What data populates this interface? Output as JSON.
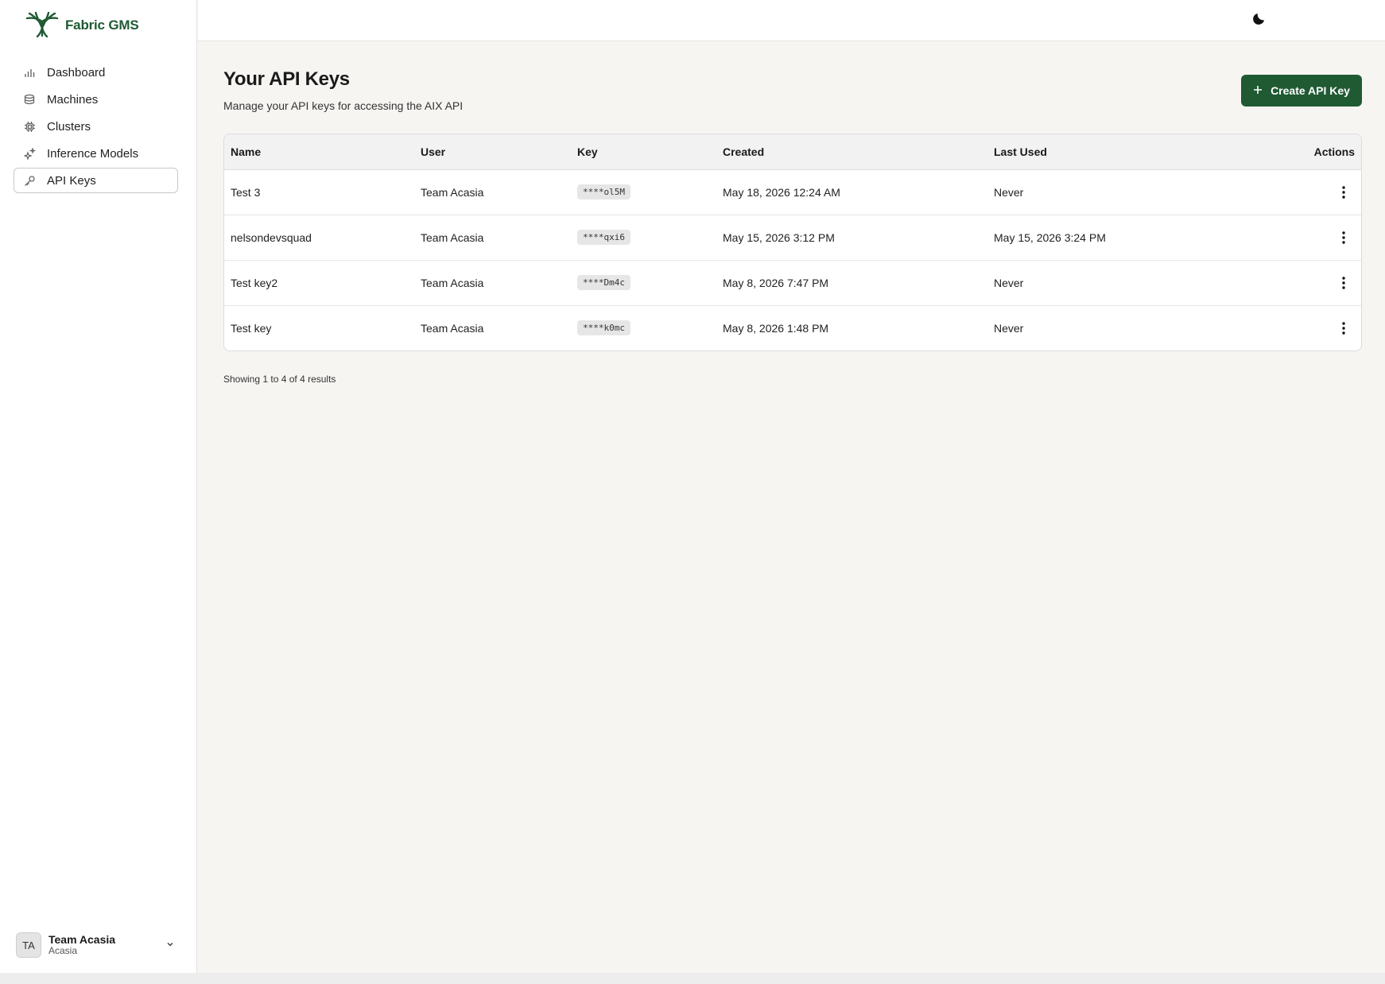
{
  "brand": {
    "name": "Fabric GMS",
    "logo_icon": "tree-logo",
    "color": "#1f5a33"
  },
  "sidebar": {
    "items": [
      {
        "label": "Dashboard",
        "icon": "bar-chart-icon"
      },
      {
        "label": "Machines",
        "icon": "server-stack-icon"
      },
      {
        "label": "Clusters",
        "icon": "cpu-chip-icon"
      },
      {
        "label": "Inference Models",
        "icon": "sparkles-icon"
      },
      {
        "label": "API Keys",
        "icon": "key-icon",
        "active": true
      }
    ],
    "user": {
      "initials": "TA",
      "name": "Team Acasia",
      "org": "Acasia"
    }
  },
  "topbar": {
    "theme_toggle_icon": "moon-icon"
  },
  "page": {
    "title": "Your API Keys",
    "subtitle": "Manage your API keys for accessing the AIX API",
    "create_button_label": "Create API Key"
  },
  "table": {
    "columns": [
      "Name",
      "User",
      "Key",
      "Created",
      "Last Used",
      "Actions"
    ],
    "rows": [
      {
        "name": "Test 3",
        "user": "Team Acasia",
        "key": "****ol5M",
        "created": "May 18, 2026 12:24 AM",
        "last_used": "Never"
      },
      {
        "name": "nelsondevsquad",
        "user": "Team Acasia",
        "key": "****qxi6",
        "created": "May 15, 2026 3:12 PM",
        "last_used": "May 15, 2026 3:24 PM"
      },
      {
        "name": "Test key2",
        "user": "Team Acasia",
        "key": "****Dm4c",
        "created": "May 8, 2026 7:47 PM",
        "last_used": "Never"
      },
      {
        "name": "Test key",
        "user": "Team Acasia",
        "key": "****k0mc",
        "created": "May 8, 2026 1:48 PM",
        "last_used": "Never"
      }
    ]
  },
  "pagination": {
    "summary": "Showing 1 to 4 of 4 results"
  }
}
